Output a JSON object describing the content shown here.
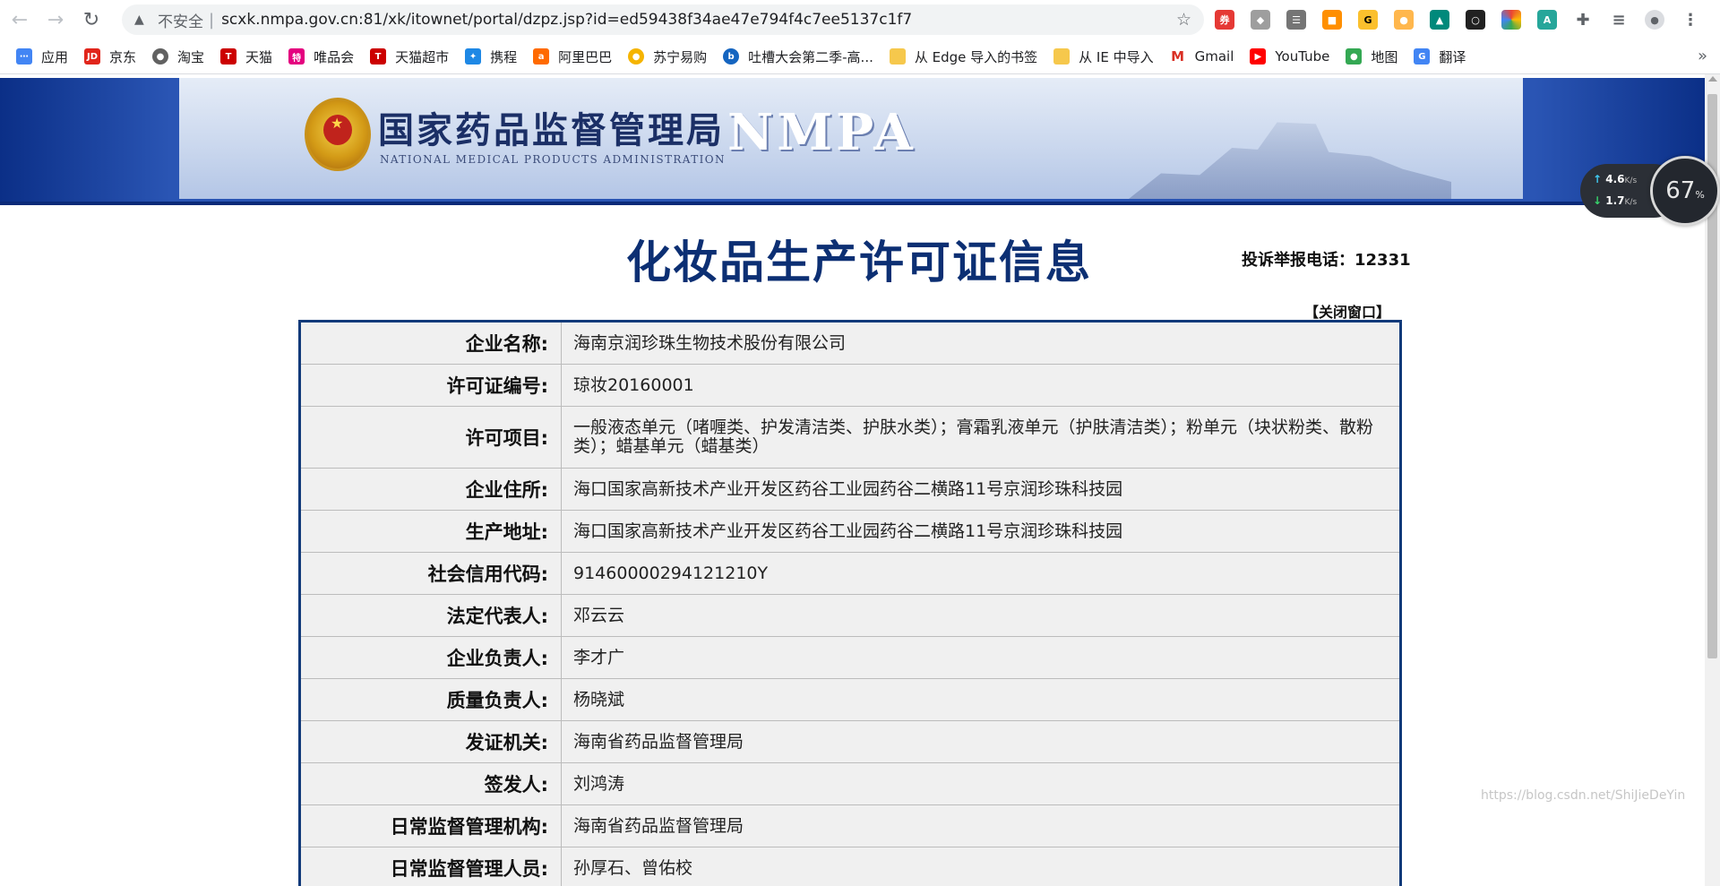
{
  "browser": {
    "security_label": "不安全",
    "url": "scxk.nmpa.gov.cn:81/xk/itownet/portal/dzpz.jsp?id=ed59438f34ae47e794f4c7ee5137c1f7",
    "bookmarks": [
      "应用",
      "京东",
      "淘宝",
      "天猫",
      "唯品会",
      "天猫超市",
      "携程",
      "阿里巴巴",
      "苏宁易购",
      "吐槽大会第二季-高...",
      "从 Edge 导入的书签",
      "从 IE 中导入",
      "Gmail",
      "YouTube",
      "地图",
      "翻译"
    ],
    "bookmark_icons": [
      "apps-icon",
      "jd-icon",
      "taobao-icon",
      "tmall-icon",
      "vip-icon",
      "tmall-market-icon",
      "ctrip-icon",
      "alibaba-icon",
      "suning-icon",
      "video-icon",
      "folder-icon",
      "folder-icon",
      "gmail-icon",
      "youtube-icon",
      "maps-icon",
      "translate-icon"
    ]
  },
  "header": {
    "agency_cn": "国家药品监督管理局",
    "agency_en": "NATIONAL MEDICAL PRODUCTS ADMINISTRATION",
    "agency_abbr": "NMPA"
  },
  "page": {
    "title": "化妆品生产许可证信息",
    "complaint_label": "投诉举报电话：",
    "complaint_phone": "12331",
    "close_window": "【关闭窗口】"
  },
  "license": {
    "rows": [
      {
        "label": "企业名称:",
        "value": "海南京润珍珠生物技术股份有限公司"
      },
      {
        "label": "许可证编号:",
        "value": "琼妆20160001"
      },
      {
        "label": "许可项目:",
        "value": "一般液态单元（啫喱类、护发清洁类、护肤水类）；膏霜乳液单元（护肤清洁类）；粉单元（块状粉类、散粉类）；蜡基单元（蜡基类）"
      },
      {
        "label": "企业住所:",
        "value": "海口国家高新技术产业开发区药谷工业园药谷二横路11号京润珍珠科技园"
      },
      {
        "label": "生产地址:",
        "value": "海口国家高新技术产业开发区药谷工业园药谷二横路11号京润珍珠科技园"
      },
      {
        "label": "社会信用代码:",
        "value": "91460000294121210Y"
      },
      {
        "label": "法定代表人:",
        "value": "邓云云"
      },
      {
        "label": "企业负责人:",
        "value": "李才广"
      },
      {
        "label": "质量负责人:",
        "value": "杨晓斌"
      },
      {
        "label": "发证机关:",
        "value": "海南省药品监督管理局"
      },
      {
        "label": "签发人:",
        "value": "刘鸿涛"
      },
      {
        "label": "日常监督管理机构:",
        "value": "海南省药品监督管理局"
      },
      {
        "label": "日常监督管理人员:",
        "value": "孙厚石、曾佑校"
      }
    ]
  },
  "overlay": {
    "upload_speed": "4.6",
    "download_speed": "1.7",
    "speed_unit": "K/s",
    "cpu_percent": "67",
    "percent_sign": "%",
    "watermark": "https://blog.csdn.net/ShiJieDeYin"
  }
}
